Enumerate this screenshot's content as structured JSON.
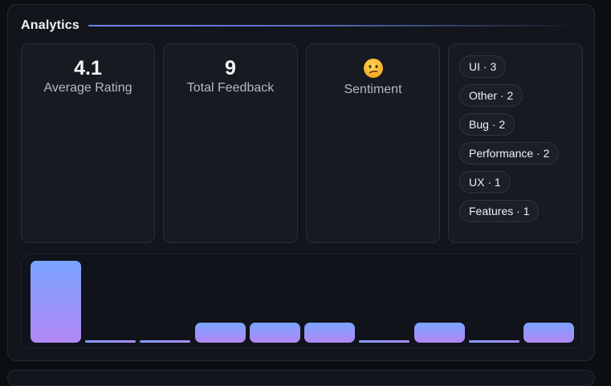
{
  "header": {
    "title": "Analytics"
  },
  "stats": {
    "average_rating": {
      "value": "4.1",
      "label": "Average Rating"
    },
    "total_feedback": {
      "value": "9",
      "label": "Total Feedback"
    },
    "sentiment": {
      "emoji": "confused-face-icon",
      "label": "Sentiment"
    }
  },
  "categories": [
    {
      "label": "UI · 3"
    },
    {
      "label": "Other · 2"
    },
    {
      "label": "Bug · 2"
    },
    {
      "label": "Performance · 2"
    },
    {
      "label": "UX · 1"
    },
    {
      "label": "Features · 1"
    }
  ],
  "chart_data": {
    "type": "bar",
    "values": [
      4,
      0,
      0,
      1,
      1,
      1,
      0,
      1,
      0,
      1
    ],
    "colors": {
      "top": "#7aa4ff",
      "bottom": "#b287f5"
    }
  },
  "colors": {
    "accent": "#6f86e6",
    "background": "#0b0e13",
    "panel": "#12151b"
  }
}
